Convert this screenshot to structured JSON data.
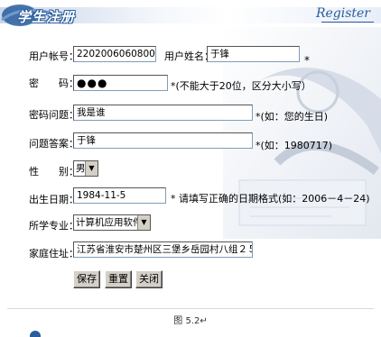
{
  "header": {
    "logo_text": "学生注册",
    "register_text": "Register"
  },
  "form": {
    "account_label": "用户帐号：",
    "account_value": "2202006060800010",
    "username_label": "用户姓名：",
    "username_value": "于锋",
    "username_star": "*",
    "password_label": "密　　码：",
    "password_value": "●●●",
    "password_note": "*(不能大于20位，区分大小写）",
    "question_label": "密码问题：",
    "question_value": "我是谁",
    "question_note": "*(如：您的生日)",
    "answer_label": "问题答案：",
    "answer_value": "于锋",
    "answer_note": "*(如：1980717)",
    "gender_label": "性　　别：",
    "gender_value": "男",
    "birth_label": "出生日期：",
    "birth_value": "1984-11-5",
    "birth_note": "* 请填写正确的日期格式(如：2006－4－24)",
    "major_label": "所学专业：",
    "major_value": "计算机应用软件",
    "address_label": "家庭住址：",
    "address_value": "江苏省淮安市楚州区三堡乡岳园村八组２５号"
  },
  "buttons": {
    "save": "保存",
    "reset": "重置",
    "close": "关闭"
  },
  "caption": "图 5.2↵",
  "colors": {
    "accent": "#2a5d9c",
    "button_face": "#d4d0c8",
    "input_border": "#7f9db9"
  }
}
